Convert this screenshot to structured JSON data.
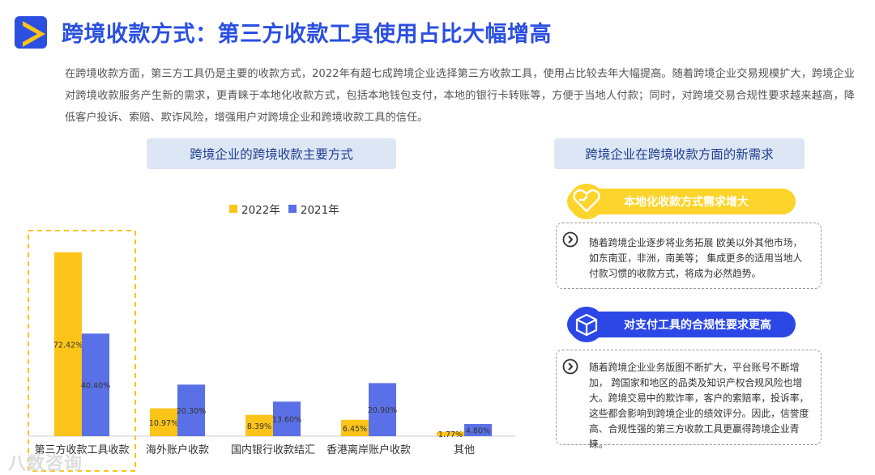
{
  "header": {
    "title": "跨境收款方式：第三方收款工具使用占比大幅增高"
  },
  "intro": "在跨境收款方面，第三方工具仍是主要的收款方式，2022年有超七成跨境企业选择第三方收款工具，使用占比较去年大幅提高。随着跨境企业交易规模扩大，跨境企业对跨境收款服务产生新的需求，更青睐于本地化收款方式，包括本地钱包支付，本地的银行卡转账等，方便于当地人付款；同时，对跨境交易合规性要求越来越高，降低客户投诉、索赔、欺诈风险，增强用户对跨境企业和跨境收款工具的信任。",
  "left_section": {
    "title": "跨境企业的跨境收款主要方式"
  },
  "right_section": {
    "title": "跨境企业在跨境收款方面的新需求",
    "cards": [
      {
        "tag": "本地化收款方式需求增大",
        "icon": "heart-icon",
        "text": "随着跨境企业逐步将业务拓展 欧美以外其他市场，如东南亚，非洲，南美等； 集成更多的适用当地人付款习惯的收款方式，将成为必然趋势。"
      },
      {
        "tag": "对支付工具的合规性要求更高",
        "icon": "cube-icon",
        "text": "随着跨境企业业务版图不断扩大，平台账号不断增加，  跨国家和地区的品类及知识产权合规风险也增大。跨境交易中的欺诈率，客户的索赔率，投诉率，这些都会影响到跨境企业的绩效评分。因此，信誉度高、合规性强的第三方收款工具更赢得跨境企业青睐。"
      }
    ]
  },
  "watermark": "八数咨询",
  "colors": {
    "c2022": "#fcc419",
    "c2021": "#5a70e6",
    "title": "#2b4fe0"
  },
  "chart_data": {
    "type": "bar",
    "categories": [
      "第三方收款工具收款",
      "海外账户收款",
      "国内银行收款结汇",
      "香港离岸账户收款",
      "其他"
    ],
    "series": [
      {
        "name": "2022年",
        "values": [
          72.42,
          10.97,
          8.39,
          6.45,
          1.77
        ],
        "labels": [
          "72.42%",
          "10.97%",
          "8.39%",
          "6.45%",
          "1.77%"
        ]
      },
      {
        "name": "2021年",
        "values": [
          40.4,
          20.3,
          13.6,
          20.9,
          4.8
        ],
        "labels": [
          "40.40%",
          "20.30%",
          "13.60%",
          "20.90%",
          "4.80%"
        ]
      }
    ],
    "ylim": [
      0,
      80
    ],
    "grid": false,
    "legend_position": "top"
  }
}
